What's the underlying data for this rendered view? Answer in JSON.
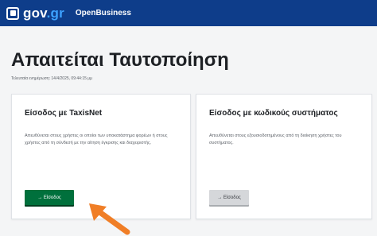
{
  "header": {
    "logo": "gov.gr",
    "logo_gov": "gov",
    "logo_gr": ".gr",
    "app_name": "OpenBusiness",
    "bg_color": "#0e3d8a"
  },
  "page": {
    "title": "Απαιτείται Ταυτοποίηση",
    "timestamp": "Τελευταία ενημέρωση: 14/4/2025, 09:44:15 μμ"
  },
  "cards": [
    {
      "title": "Είσοδος με TaxisNet",
      "description": "Απευθύνεται στους χρήστες οι οποίοι των υποκατάστημα φορέων ή στους χρήστες από τη σύνδεσή με την αίτηση έγκρισης και διαχειριστής.",
      "button_label": "→ Είσοδος",
      "button_color": "#00703c"
    },
    {
      "title": "Είσοδος με κωδικούς συστήματος",
      "description": "Απευθύνεται στους εξουσιοδοτημένους από τη διοίκηση χρήστες του συστήματος.",
      "button_label": "→ Είσοδος",
      "button_color": "#d5d7da"
    }
  ],
  "annotation": {
    "arrow_icon": "pointer-arrow-icon",
    "arrow_color": "#f07e26"
  }
}
